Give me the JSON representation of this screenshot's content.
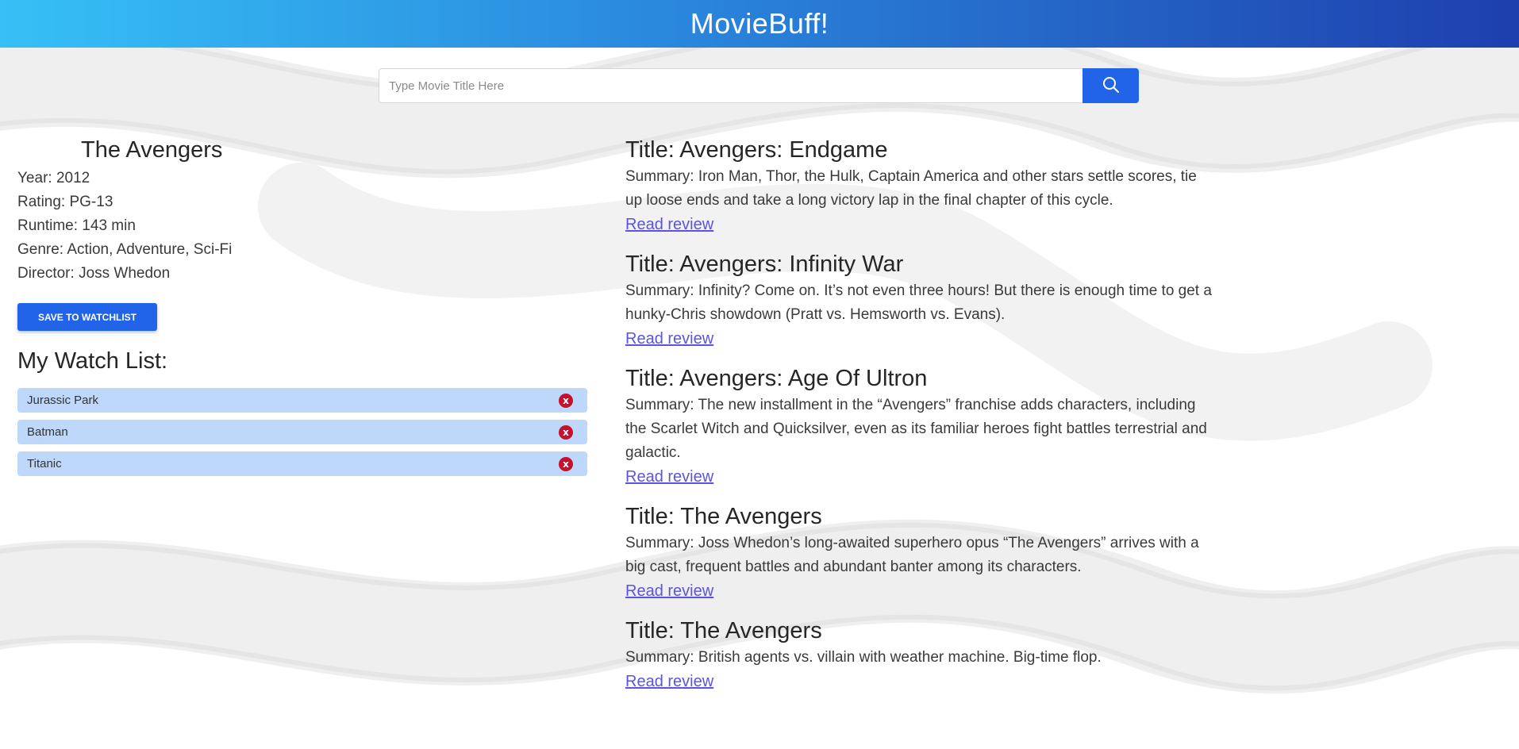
{
  "header": {
    "title": "MovieBuff!"
  },
  "search": {
    "placeholder": "Type Movie Title Here",
    "value": "",
    "button_icon": "search-icon"
  },
  "movie": {
    "title": "The Avengers",
    "year": "Year: 2012",
    "rating": "Rating: PG-13",
    "runtime": "Runtime: 143 min",
    "genre": "Genre: Action, Adventure, Sci-Fi",
    "director": "Director: Joss Whedon",
    "save_label": "SAVE TO WATCHLIST"
  },
  "watchlist": {
    "heading": "My Watch List:",
    "remove_glyph": "x",
    "items": [
      {
        "label": "Jurassic Park"
      },
      {
        "label": "Batman"
      },
      {
        "label": "Titanic"
      }
    ]
  },
  "results": [
    {
      "title": "Title: Avengers: Endgame",
      "summary": "Summary: Iron Man, Thor, the Hulk, Captain America and other stars settle scores, tie up loose ends and take a long victory lap in the final chapter of this cycle.",
      "link": "Read review"
    },
    {
      "title": "Title: Avengers: Infinity War",
      "summary": "Summary: Infinity? Come on. It’s not even three hours! But there is enough time to get a hunky-Chris showdown (Pratt vs. Hemsworth vs. Evans).",
      "link": "Read review"
    },
    {
      "title": "Title: Avengers: Age Of Ultron",
      "summary": "Summary: The new installment in the “Avengers” franchise adds characters, including the Scarlet Witch and Quicksilver, even as its familiar heroes fight battles terrestrial and galactic.",
      "link": "Read review"
    },
    {
      "title": "Title: The Avengers",
      "summary": "Summary: Joss Whedon’s long-awaited superhero opus “The Avengers” arrives with a big cast, frequent battles and abundant banter among its characters.",
      "link": "Read review"
    },
    {
      "title": "Title: The Avengers",
      "summary": "Summary: British agents vs. villain with weather machine. Big-time flop.",
      "link": "Read review"
    }
  ],
  "colors": {
    "accent": "#2164e8",
    "header_start": "#36c0f6",
    "header_end": "#1e3fae",
    "watchlist_item": "#bdd8fb",
    "remove": "#c8102e",
    "link": "#5b54e0"
  }
}
